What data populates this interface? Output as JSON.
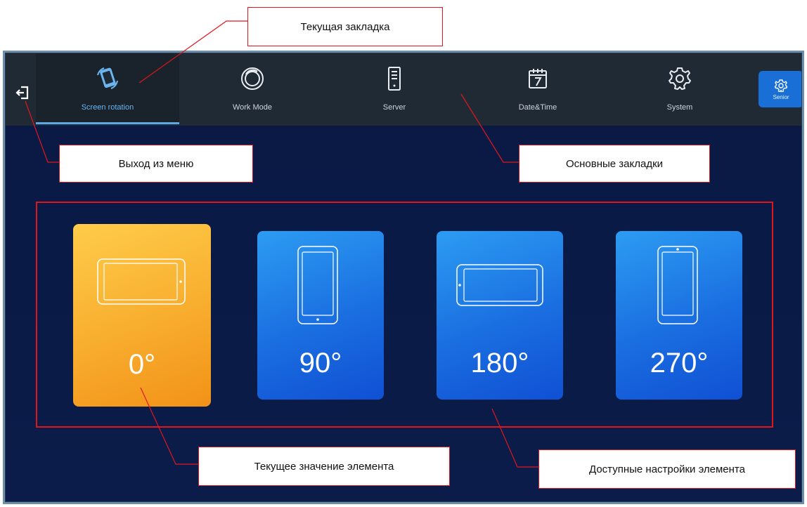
{
  "window": {
    "tabs": [
      {
        "label": "Screen rotation",
        "icon": "screen-rotation-icon",
        "active": true
      },
      {
        "label": "Work Mode",
        "icon": "work-mode-icon",
        "active": false
      },
      {
        "label": "Server",
        "icon": "server-icon",
        "active": false
      },
      {
        "label": "Date&Time",
        "icon": "calendar-icon",
        "active": false
      },
      {
        "label": "System",
        "icon": "gear-icon",
        "active": false
      }
    ],
    "senior": {
      "label": "Senior",
      "icon": "settings-gear-icon"
    },
    "exit": {
      "icon": "exit-icon"
    }
  },
  "rotation": {
    "options": [
      {
        "label": "0°",
        "selected": true,
        "icon": "tablet-landscape-icon"
      },
      {
        "label": "90°",
        "selected": false,
        "icon": "tablet-portrait-icon"
      },
      {
        "label": "180°",
        "selected": false,
        "icon": "tablet-landscape-icon"
      },
      {
        "label": "270°",
        "selected": false,
        "icon": "tablet-portrait-icon"
      }
    ]
  },
  "annotations": {
    "current_tab": "Текущая закладка",
    "exit_menu": "Выход из меню",
    "main_tabs": "Основные закладки",
    "current_value": "Текущее значение элемента",
    "available_settings": "Доступные настройки элемента"
  },
  "colors": {
    "background": "#0b1a44",
    "topbar": "#202a34",
    "active_tab_underline": "#5aa8e6",
    "card_blue": "#1a6ee0",
    "card_selected": "#f8ad2e",
    "annotation_border": "#e0161c",
    "senior_button": "#1a6fd6"
  }
}
